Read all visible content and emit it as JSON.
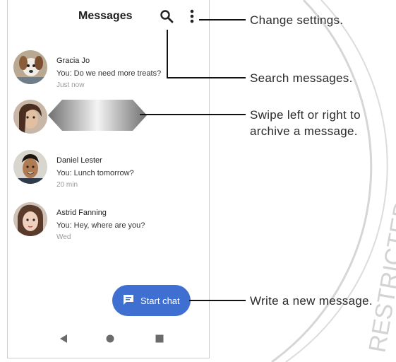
{
  "header": {
    "title": "Messages"
  },
  "conversations": [
    {
      "name": "Gracia Jo",
      "snippet": "You: Do we need more treats?",
      "time": "Just now"
    },
    {
      "name": "Daniel Lester",
      "snippet": "You: Lunch tomorrow?",
      "time": "20 min"
    },
    {
      "name": "Astrid Fanning",
      "snippet": "You: Hey, where are you?",
      "time": "Wed"
    }
  ],
  "fab": {
    "label": "Start chat"
  },
  "callouts": {
    "settings": "Change settings.",
    "search": "Search messages.",
    "swipe_line1": "Swipe left or right to",
    "swipe_line2": "archive a message.",
    "write": "Write a new message."
  },
  "watermark": "RESTRICTED :: MOTOROLA",
  "colors": {
    "accent": "#3f6fd1",
    "watermark": "#d3d3d3"
  },
  "icons": [
    "search-icon",
    "more-vert-icon",
    "message-icon",
    "back-icon",
    "home-icon",
    "recents-icon"
  ]
}
